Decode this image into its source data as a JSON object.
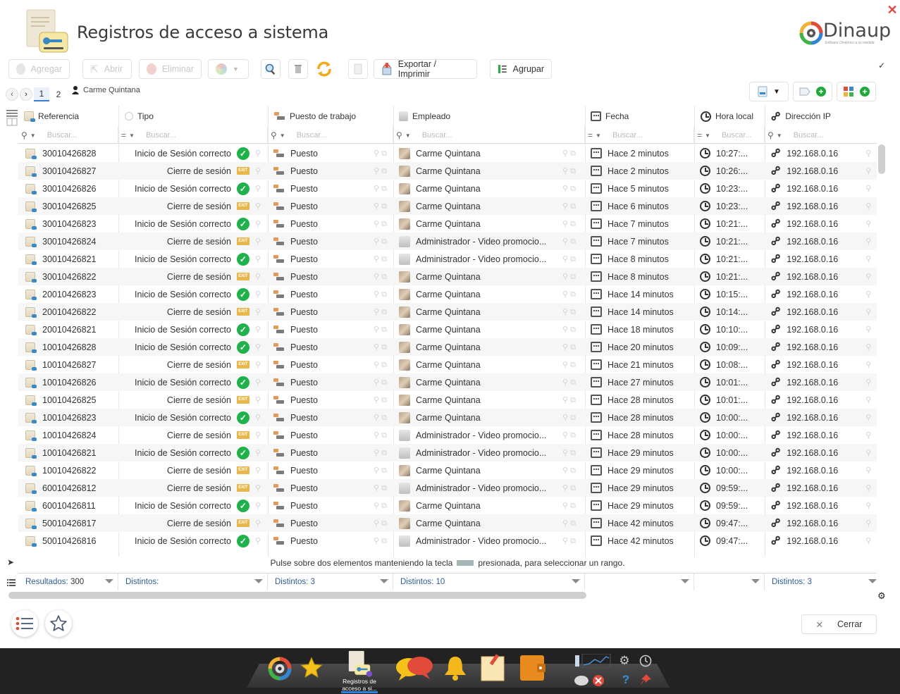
{
  "window": {
    "title": "Registros de acceso a sistema",
    "close_label": "✕"
  },
  "brand": {
    "name": "Dinaup",
    "tagline": "Software Dinámico a su medida"
  },
  "toolbar": {
    "add_label": "Agregar",
    "open_label": "Abrir",
    "delete_label": "Eliminar",
    "export_label": "Exportar / Imprimir",
    "group_label": "Agrupar"
  },
  "pager": {
    "pages": [
      "1",
      "2"
    ],
    "current": "1",
    "user": "Carme Quintana"
  },
  "columns": {
    "ref": "Referencia",
    "tipo": "Tipo",
    "puesto": "Puesto de trabajo",
    "empleado": "Empleado",
    "fecha": "Fecha",
    "hora": "Hora local",
    "ip": "Dirección IP",
    "search_placeholder": "Buscar..."
  },
  "rows": [
    {
      "ref": "30010426828",
      "tipo": "Inicio de Sesión correcto",
      "kind": "ok",
      "puesto": "Puesto",
      "empleado": "Carme Quintana",
      "admin": false,
      "fecha": "Hace 2 minutos",
      "hora": "10:27:...",
      "ip": "192.168.0.16"
    },
    {
      "ref": "30010426827",
      "tipo": "Cierre de sesión",
      "kind": "exit",
      "puesto": "Puesto",
      "empleado": "Carme Quintana",
      "admin": false,
      "fecha": "Hace 2 minutos",
      "hora": "10:26:...",
      "ip": "192.168.0.16"
    },
    {
      "ref": "30010426826",
      "tipo": "Inicio de Sesión correcto",
      "kind": "ok",
      "puesto": "Puesto",
      "empleado": "Carme Quintana",
      "admin": false,
      "fecha": "Hace 5 minutos",
      "hora": "10:23:...",
      "ip": "192.168.0.16"
    },
    {
      "ref": "30010426825",
      "tipo": "Cierre de sesión",
      "kind": "exit",
      "puesto": "Puesto",
      "empleado": "Carme Quintana",
      "admin": false,
      "fecha": "Hace 6 minutos",
      "hora": "10:23:...",
      "ip": "192.168.0.16"
    },
    {
      "ref": "30010426823",
      "tipo": "Inicio de Sesión correcto",
      "kind": "ok",
      "puesto": "Puesto",
      "empleado": "Carme Quintana",
      "admin": false,
      "fecha": "Hace 7 minutos",
      "hora": "10:21:...",
      "ip": "192.168.0.16"
    },
    {
      "ref": "30010426824",
      "tipo": "Cierre de sesión",
      "kind": "exit",
      "puesto": "Puesto",
      "empleado": "Administrador - Video promocio...",
      "admin": true,
      "fecha": "Hace 7 minutos",
      "hora": "10:21:...",
      "ip": "192.168.0.16"
    },
    {
      "ref": "30010426821",
      "tipo": "Inicio de Sesión correcto",
      "kind": "ok",
      "puesto": "Puesto",
      "empleado": "Administrador - Video promocio...",
      "admin": true,
      "fecha": "Hace 8 minutos",
      "hora": "10:21:...",
      "ip": "192.168.0.16"
    },
    {
      "ref": "30010426822",
      "tipo": "Cierre de sesión",
      "kind": "exit",
      "puesto": "Puesto",
      "empleado": "Carme Quintana",
      "admin": false,
      "fecha": "Hace 8 minutos",
      "hora": "10:21:...",
      "ip": "192.168.0.16"
    },
    {
      "ref": "20010426823",
      "tipo": "Inicio de Sesión correcto",
      "kind": "ok",
      "puesto": "Puesto",
      "empleado": "Carme Quintana",
      "admin": false,
      "fecha": "Hace 14 minutos",
      "hora": "10:15:...",
      "ip": "192.168.0.16"
    },
    {
      "ref": "20010426822",
      "tipo": "Cierre de sesión",
      "kind": "exit",
      "puesto": "Puesto",
      "empleado": "Carme Quintana",
      "admin": false,
      "fecha": "Hace 14 minutos",
      "hora": "10:14:...",
      "ip": "192.168.0.16"
    },
    {
      "ref": "20010426821",
      "tipo": "Inicio de Sesión correcto",
      "kind": "ok",
      "puesto": "Puesto",
      "empleado": "Carme Quintana",
      "admin": false,
      "fecha": "Hace 18 minutos",
      "hora": "10:10:...",
      "ip": "192.168.0.16"
    },
    {
      "ref": "10010426828",
      "tipo": "Inicio de Sesión correcto",
      "kind": "ok",
      "puesto": "Puesto",
      "empleado": "Carme Quintana",
      "admin": false,
      "fecha": "Hace 20 minutos",
      "hora": "10:09:...",
      "ip": "192.168.0.16"
    },
    {
      "ref": "10010426827",
      "tipo": "Cierre de sesión",
      "kind": "exit",
      "puesto": "Puesto",
      "empleado": "Carme Quintana",
      "admin": false,
      "fecha": "Hace 21 minutos",
      "hora": "10:08:...",
      "ip": "192.168.0.16"
    },
    {
      "ref": "10010426826",
      "tipo": "Inicio de Sesión correcto",
      "kind": "ok",
      "puesto": "Puesto",
      "empleado": "Carme Quintana",
      "admin": false,
      "fecha": "Hace 27 minutos",
      "hora": "10:01:...",
      "ip": "192.168.0.16"
    },
    {
      "ref": "10010426825",
      "tipo": "Cierre de sesión",
      "kind": "exit",
      "puesto": "Puesto",
      "empleado": "Carme Quintana",
      "admin": false,
      "fecha": "Hace 28 minutos",
      "hora": "10:01:...",
      "ip": "192.168.0.16"
    },
    {
      "ref": "10010426823",
      "tipo": "Inicio de Sesión correcto",
      "kind": "ok",
      "puesto": "Puesto",
      "empleado": "Carme Quintana",
      "admin": false,
      "fecha": "Hace 28 minutos",
      "hora": "10:00:...",
      "ip": "192.168.0.16"
    },
    {
      "ref": "10010426824",
      "tipo": "Cierre de sesión",
      "kind": "exit",
      "puesto": "Puesto",
      "empleado": "Administrador - Video promocio...",
      "admin": true,
      "fecha": "Hace 28 minutos",
      "hora": "10:00:...",
      "ip": "192.168.0.16"
    },
    {
      "ref": "10010426821",
      "tipo": "Inicio de Sesión correcto",
      "kind": "ok",
      "puesto": "Puesto",
      "empleado": "Administrador - Video promocio...",
      "admin": true,
      "fecha": "Hace 29 minutos",
      "hora": "10:00:...",
      "ip": "192.168.0.16"
    },
    {
      "ref": "10010426822",
      "tipo": "Cierre de sesión",
      "kind": "exit",
      "puesto": "Puesto",
      "empleado": "Carme Quintana",
      "admin": false,
      "fecha": "Hace 29 minutos",
      "hora": "10:00:...",
      "ip": "192.168.0.16"
    },
    {
      "ref": "60010426812",
      "tipo": "Cierre de sesión",
      "kind": "exit",
      "puesto": "Puesto",
      "empleado": "Administrador - Video promocio...",
      "admin": true,
      "fecha": "Hace 29 minutos",
      "hora": "09:59:...",
      "ip": "192.168.0.16"
    },
    {
      "ref": "60010426811",
      "tipo": "Inicio de Sesión correcto",
      "kind": "ok",
      "puesto": "Puesto",
      "empleado": "Carme Quintana",
      "admin": false,
      "fecha": "Hace 29 minutos",
      "hora": "09:59:...",
      "ip": "192.168.0.16"
    },
    {
      "ref": "50010426817",
      "tipo": "Cierre de sesión",
      "kind": "exit",
      "puesto": "Puesto",
      "empleado": "Carme Quintana",
      "admin": false,
      "fecha": "Hace 42 minutos",
      "hora": "09:47:...",
      "ip": "192.168.0.16"
    },
    {
      "ref": "50010426816",
      "tipo": "Inicio de Sesión correcto",
      "kind": "ok",
      "puesto": "Puesto",
      "empleado": "Administrador - Video promocio...",
      "admin": true,
      "fecha": "Hace 42 minutos",
      "hora": "09:47:...",
      "ip": "192.168.0.16"
    }
  ],
  "hint": {
    "before": "Pulse sobre dos elementos manteniendo la tecla",
    "after": "presionada, para seleccionar un rango."
  },
  "footer": {
    "results_label": "Resultados:",
    "results_value": "300",
    "distinct_tipo": "Distintos:",
    "distinct_puesto": "Distintos: 3",
    "distinct_empleado": "Distintos: 10",
    "distinct_ip": "Distintos: 3"
  },
  "buttons": {
    "close_label": "Cerrar",
    "close_x": "✕"
  },
  "taskbar": {
    "active_label": "Registros de acceso a si..."
  },
  "colors": {
    "ok": "#1fb24a",
    "exit": "#e8b64a",
    "accent": "#2e5d95",
    "close": "#e04a43"
  }
}
